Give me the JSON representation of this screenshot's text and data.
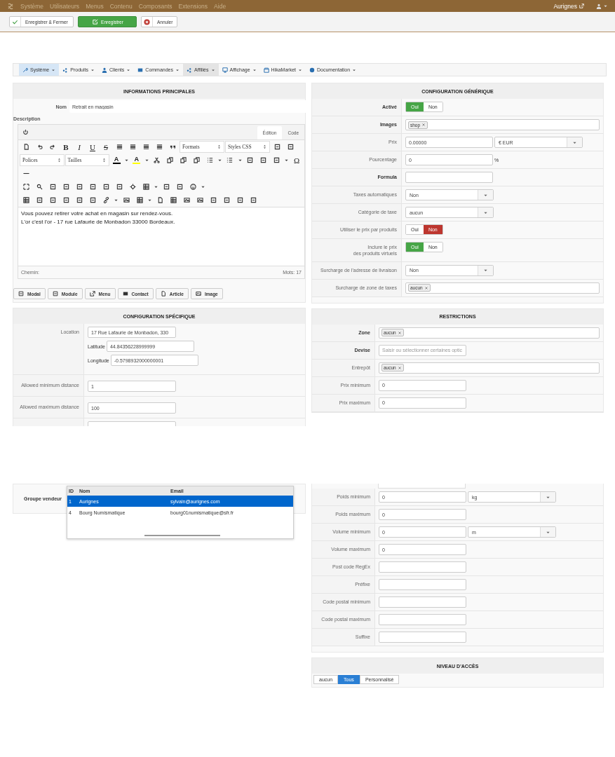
{
  "top_nav": {
    "items": [
      "Système",
      "Utilisateurs",
      "Menus",
      "Contenu",
      "Composants",
      "Extensions",
      "Aide"
    ],
    "site": "Aurignes"
  },
  "toolbar": [
    {
      "label": "Enregistrer & Fermer",
      "kind": "save_close"
    },
    {
      "label": "Enregistrer",
      "kind": "save"
    },
    {
      "label": "Annuler",
      "kind": "cancel"
    }
  ],
  "menu_bar": [
    {
      "label": "Système",
      "selected": true,
      "hovered": false
    },
    {
      "label": "Produits",
      "selected": false,
      "hovered": false
    },
    {
      "label": "Clients",
      "selected": false,
      "hovered": false
    },
    {
      "label": "Commandes",
      "selected": false,
      "hovered": false
    },
    {
      "label": "Affiliés",
      "selected": false,
      "hovered": true
    },
    {
      "label": "Affichage",
      "selected": false,
      "hovered": false
    },
    {
      "label": "HikaMarket",
      "selected": false,
      "hovered": false
    },
    {
      "label": "Documentation",
      "selected": false,
      "hovered": false
    }
  ],
  "main_info": {
    "title": "INFORMATIONS PRINCIPALES",
    "name_label": "Nom",
    "name_value": "Retrait en magasin",
    "description_label": "Description",
    "editor": {
      "tabs": [
        {
          "label": "Édition",
          "selected": true
        },
        {
          "label": "Code",
          "selected": false
        }
      ],
      "toolbar_rows": [
        [
          {
            "kind": "icon"
          },
          {
            "kind": "icon"
          },
          {
            "kind": "icon"
          },
          {
            "kind": "bold",
            "text": "B"
          },
          {
            "kind": "italic",
            "text": "I"
          },
          {
            "kind": "underline",
            "text": "U"
          },
          {
            "kind": "strike",
            "text": "S"
          },
          {
            "kind": "icon"
          },
          {
            "kind": "icon"
          },
          {
            "kind": "icon"
          },
          {
            "kind": "icon"
          },
          {
            "kind": "icon"
          },
          {
            "kind": "select",
            "text": "Formats"
          },
          {
            "kind": "select",
            "text": "Styles CSS"
          },
          {
            "kind": "icon"
          },
          {
            "kind": "icon"
          }
        ],
        [
          {
            "kind": "select",
            "text": "Polices"
          },
          {
            "kind": "select",
            "text": "Tailles"
          },
          {
            "kind": "color",
            "text": "A",
            "color": "#000000"
          },
          {
            "kind": "caret"
          },
          {
            "kind": "color",
            "text": "A",
            "color": "#ffff00"
          },
          {
            "kind": "caret"
          },
          {
            "kind": "icon"
          },
          {
            "kind": "icon"
          },
          {
            "kind": "icon"
          },
          {
            "kind": "icon"
          },
          {
            "kind": "icon"
          },
          {
            "kind": "caret"
          },
          {
            "kind": "icon"
          },
          {
            "kind": "caret"
          },
          {
            "kind": "icon"
          },
          {
            "kind": "icon"
          },
          {
            "kind": "icon"
          },
          {
            "kind": "caret"
          },
          {
            "kind": "glyph",
            "text": "Ω"
          }
        ],
        [
          {
            "kind": "icon"
          }
        ],
        [
          {
            "kind": "icon"
          },
          {
            "kind": "icon"
          },
          {
            "kind": "icon"
          },
          {
            "kind": "icon"
          },
          {
            "kind": "icon"
          },
          {
            "kind": "icon"
          },
          {
            "kind": "icon"
          },
          {
            "kind": "icon"
          },
          {
            "kind": "icon"
          },
          {
            "kind": "icon"
          },
          {
            "kind": "caret"
          },
          {
            "kind": "icon"
          },
          {
            "kind": "icon"
          },
          {
            "kind": "icon"
          },
          {
            "kind": "caret"
          }
        ],
        [
          {
            "kind": "icon"
          },
          {
            "kind": "icon"
          },
          {
            "kind": "icon"
          },
          {
            "kind": "icon"
          },
          {
            "kind": "icon"
          },
          {
            "kind": "icon"
          },
          {
            "kind": "icon"
          },
          {
            "kind": "caret"
          },
          {
            "kind": "icon"
          },
          {
            "kind": "icon"
          },
          {
            "kind": "caret"
          },
          {
            "kind": "icon"
          },
          {
            "kind": "icon"
          },
          {
            "kind": "icon"
          },
          {
            "kind": "icon"
          },
          {
            "kind": "icon"
          },
          {
            "kind": "icon"
          },
          {
            "kind": "icon"
          },
          {
            "kind": "icon"
          }
        ]
      ],
      "content": [
        "Vous pouvez retirer votre achat en magasin sur rendez-vous.",
        "L'or c'est l'or - 17 rue Lafaurie de Monbadon 33000 Bordeaux."
      ],
      "path_label": "Chemin:",
      "word_count": "Mots: 17"
    },
    "insert_buttons": [
      "Modal",
      "Module",
      "Menu",
      "Contact",
      "Article",
      "Image"
    ]
  },
  "specific_config": {
    "title": "CONFIGURATION SPÉCIFIQUE",
    "location_label": "Location",
    "location_value": "17 Rue Lafaurie de Monbadon, 330",
    "latitude_label": "Latitude",
    "latitude_value": "44.84356228999999",
    "longitude_label": "Longitude",
    "longitude_value": "-0.5798932000000001",
    "rows": [
      {
        "label": "Allowed minimum distance",
        "value": "1"
      },
      {
        "label": "Allowed maximum distance",
        "value": "100"
      }
    ]
  },
  "vendor_group": {
    "label": "Groupe vendeur",
    "columns": [
      "ID",
      "Nom",
      "Email"
    ],
    "rows": [
      {
        "cells": [
          "1",
          "Aurignes",
          "sylvain@aurignes.com"
        ],
        "selected": true
      },
      {
        "cells": [
          "4",
          "Bourg Numismatique",
          "bourg01numismatique@sfr.fr"
        ],
        "selected": false
      }
    ]
  },
  "generic_config": {
    "title": "CONFIGURATION GÉNÉRIQUE",
    "rows": [
      {
        "label": "Activé",
        "bold": true,
        "kind": "toggle",
        "options": [
          {
            "label": "Oui",
            "kind": "yes",
            "selected": true
          },
          {
            "label": "Non",
            "kind": "no",
            "selected": false
          }
        ]
      },
      {
        "label": "Images",
        "bold": true,
        "kind": "tags",
        "tags": [
          "shop"
        ]
      },
      {
        "label": "Prix",
        "bold": false,
        "kind": "unit",
        "value": "0.00000",
        "unit": "€ EUR"
      },
      {
        "label": "Pourcentage",
        "bold": false,
        "kind": "text",
        "value": "0",
        "suffix": "%"
      },
      {
        "label": "Formula",
        "bold": true,
        "kind": "text"
      },
      {
        "label": "Taxes automatiques",
        "bold": false,
        "kind": "select",
        "value": "Non"
      },
      {
        "label": "Catégorie de taxe",
        "bold": false,
        "kind": "select",
        "value": "aucun"
      },
      {
        "label": "Utiliser le prix par produits",
        "bold": false,
        "kind": "toggle",
        "options": [
          {
            "label": "Oui",
            "kind": "yes",
            "selected": false
          },
          {
            "label": "Non",
            "kind": "no",
            "selected": true
          }
        ]
      },
      {
        "label": "Inclure le prix\ndes produits virtuels",
        "bold": false,
        "kind": "toggle",
        "options": [
          {
            "label": "Oui",
            "kind": "yes",
            "selected": true
          },
          {
            "label": "Non",
            "kind": "no",
            "selected": false
          }
        ]
      },
      {
        "label": "Surcharge de l'adresse de livraison",
        "bold": false,
        "kind": "select",
        "value": "Non"
      },
      {
        "label": "Surcharge de zone de taxes",
        "bold": false,
        "kind": "tags",
        "tags": [
          "aucun"
        ]
      }
    ]
  },
  "restrictions": {
    "title": "RESTRICTIONS",
    "rows": [
      {
        "label": "Zone",
        "bold": true,
        "kind": "tags",
        "tags": [
          "aucun"
        ]
      },
      {
        "label": "Devise",
        "bold": true,
        "kind": "text",
        "placeholder": "Saisir ou sélectionner certaines optic"
      },
      {
        "label": "Entrepôt",
        "bold": false,
        "kind": "tags",
        "tags": [
          "aucun"
        ]
      },
      {
        "label": "Prix minimum",
        "bold": false,
        "kind": "text",
        "value": "0"
      },
      {
        "label": "Prix maximum",
        "bold": false,
        "kind": "text",
        "value": "0"
      }
    ],
    "rows_continued": [
      {
        "label": "Poids minimum",
        "bold": false,
        "kind": "unit",
        "value": "0",
        "unit": "kg"
      },
      {
        "label": "Poids maximum",
        "bold": false,
        "kind": "text",
        "value": "0"
      },
      {
        "label": "Volume minimum",
        "bold": false,
        "kind": "unit",
        "value": "0",
        "unit": "m"
      },
      {
        "label": "Volume maximum",
        "bold": false,
        "kind": "text",
        "value": "0"
      },
      {
        "label": "Post code RegEx",
        "bold": false,
        "kind": "text"
      },
      {
        "label": "Préfixe",
        "bold": false,
        "kind": "text"
      },
      {
        "label": "Code postal minimum",
        "bold": false,
        "kind": "text"
      },
      {
        "label": "Code postal maximum",
        "bold": false,
        "kind": "text"
      },
      {
        "label": "Suffixe",
        "bold": false,
        "kind": "text"
      }
    ]
  },
  "access_level": {
    "title": "NIVEAU D'ACCÈS",
    "options": [
      {
        "label": "aucun",
        "selected": false
      },
      {
        "label": "Tous",
        "selected": true
      },
      {
        "label": "Personnalisé",
        "selected": false
      }
    ]
  }
}
